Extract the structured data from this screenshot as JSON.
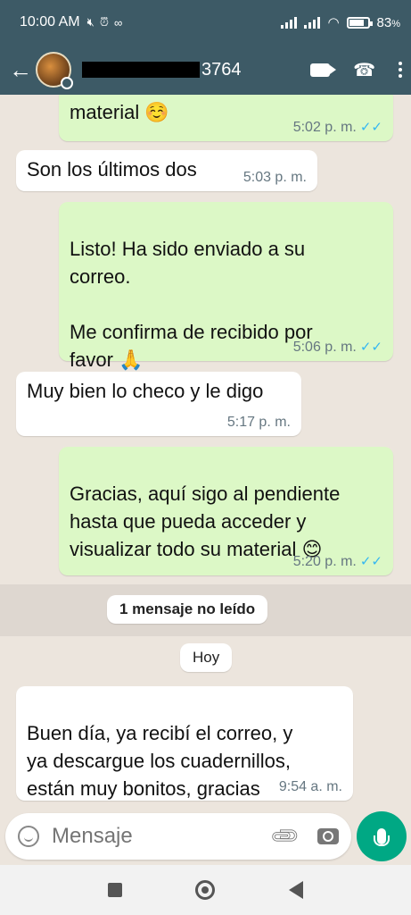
{
  "status_bar": {
    "time": "10:00 AM",
    "battery": "83",
    "battery_suffix": "%"
  },
  "header": {
    "contact_suffix": "3764"
  },
  "messages": [
    {
      "dir": "out",
      "text": "material ☺️",
      "time": "5:02 p. m.",
      "read": true
    },
    {
      "dir": "in",
      "text": "Son los últimos dos",
      "time": "5:03 p. m."
    },
    {
      "dir": "out",
      "text": "Listo! Ha sido enviado a su\ncorreo.\n\nMe confirma de recibido por\nfavor 🙏",
      "time": "5:06 p. m.",
      "read": true
    },
    {
      "dir": "in",
      "text": "Muy bien lo checo y le digo",
      "time": "5:17 p. m."
    },
    {
      "dir": "out",
      "text": "Gracias, aquí sigo al pendiente\nhasta que pueda acceder y\nvisualizar todo su material 😊",
      "time": "5:20 p. m.",
      "read": true
    },
    {
      "dir": "in",
      "text": "Buen día, ya recibí el correo, y\nya descargue los cuadernillos,\nestán muy bonitos, gracias",
      "time": "9:54 a. m."
    }
  ],
  "unread_label": "1 mensaje no leído",
  "day_label": "Hoy",
  "composer": {
    "placeholder": "Mensaje"
  },
  "colors": {
    "header": "#3d5a66",
    "outgoing_bubble": "#dcf8c6",
    "incoming_bubble": "#ffffff",
    "read_ticks": "#34b7f1",
    "mic_button": "#00a884"
  }
}
